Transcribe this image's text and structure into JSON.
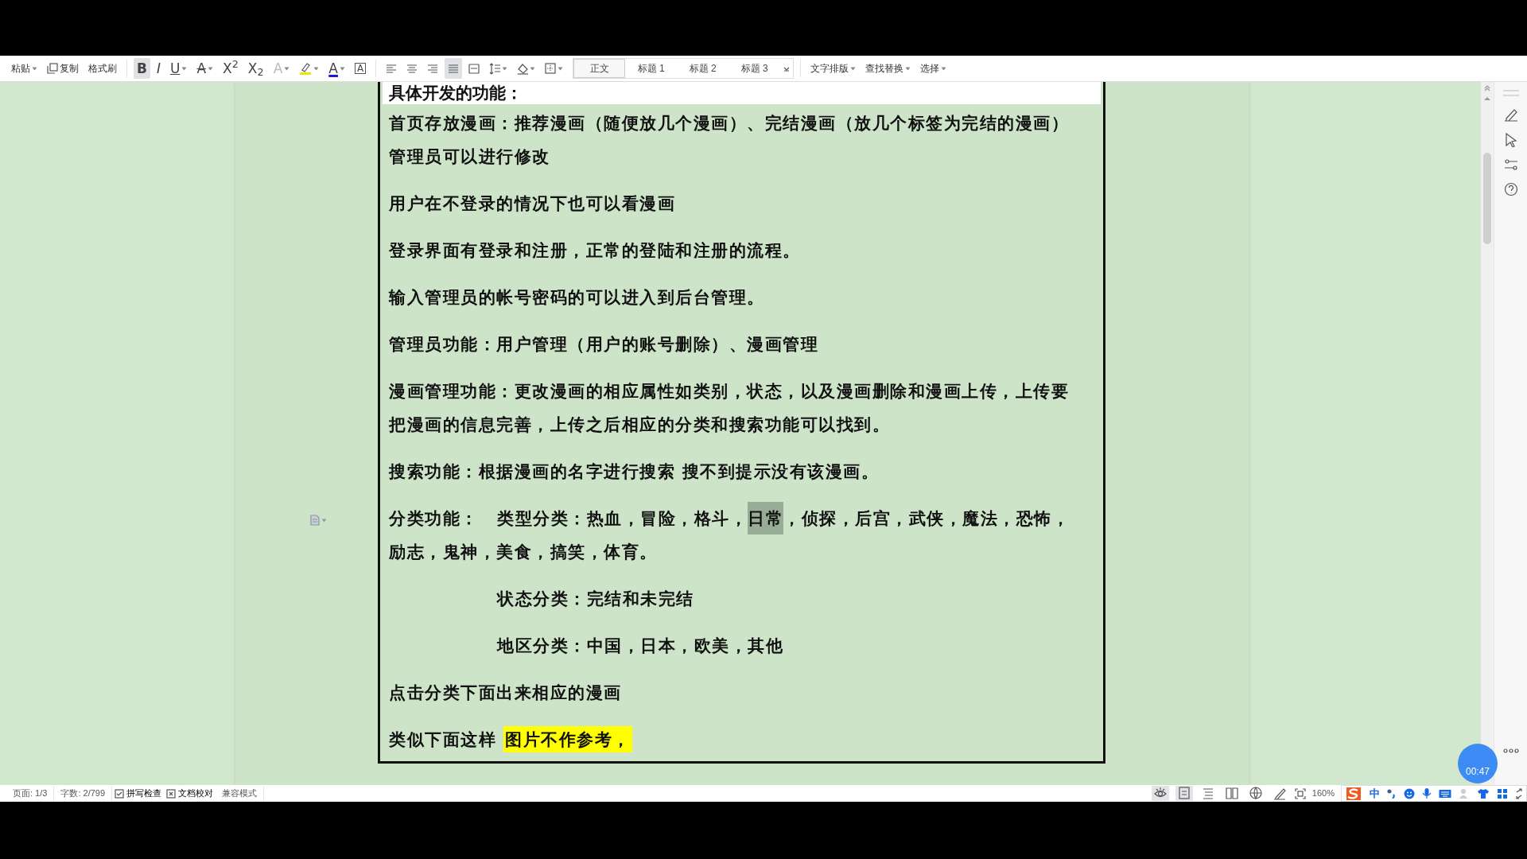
{
  "toolbar": {
    "clipboard": [
      {
        "kind": "paste",
        "label": "粘贴",
        "dropdown": true
      },
      {
        "kind": "copy",
        "label": "复制",
        "dropdown": false
      },
      {
        "kind": "painter",
        "label": "格式刷",
        "dropdown": false
      }
    ],
    "font_buttons": [
      {
        "kind": "bold",
        "glyph": "B",
        "selected": true,
        "dropdown": false
      },
      {
        "kind": "italic",
        "glyph": "I",
        "selected": false,
        "dropdown": false
      },
      {
        "kind": "underline",
        "glyph": "U",
        "selected": false,
        "dropdown": true
      },
      {
        "kind": "strike",
        "glyph": "A",
        "selected": false,
        "dropdown": true
      },
      {
        "kind": "superscript",
        "glyph": "X$^{2}$",
        "selected": false,
        "dropdown": false
      },
      {
        "kind": "subscript",
        "glyph": "X$_{2}$",
        "selected": false,
        "dropdown": false
      },
      {
        "kind": "effect",
        "glyph": "A",
        "selected": false,
        "dropdown": true
      },
      {
        "kind": "highlight",
        "selected": false,
        "dropdown": true
      },
      {
        "kind": "font-color",
        "glyph": "A",
        "selected": false,
        "dropdown": true
      },
      {
        "kind": "char-border",
        "glyph": "A",
        "selected": false,
        "dropdown": false
      }
    ],
    "paragraph_buttons": [
      {
        "kind": "align-left",
        "selected": false,
        "dropdown": false
      },
      {
        "kind": "align-center",
        "selected": false,
        "dropdown": false
      },
      {
        "kind": "align-right",
        "selected": false,
        "dropdown": false
      },
      {
        "kind": "justify",
        "selected": true,
        "dropdown": false
      },
      {
        "kind": "distribute",
        "selected": false,
        "dropdown": false
      },
      {
        "kind": "line-spacing",
        "selected": false,
        "dropdown": true
      },
      {
        "kind": "shading",
        "selected": false,
        "dropdown": true
      },
      {
        "kind": "borders",
        "selected": false,
        "dropdown": true
      }
    ],
    "styles": [
      {
        "label": "正文",
        "selected": true
      },
      {
        "label": "标题 1",
        "selected": false
      },
      {
        "label": "标题 2",
        "selected": false
      },
      {
        "label": "标题 3",
        "selected": false
      }
    ],
    "menus": [
      "文字排版",
      "查找替换",
      "选择"
    ]
  },
  "document": {
    "cut_line": "具体开发的功能：",
    "paragraphs": [
      {
        "kind": "plain",
        "lines": [
          [
            {
              "text": "首页存放漫画：推荐漫画（随便放几个漫画）、完结漫画（放几个标签为完结的漫画）"
            }
          ],
          [
            {
              "text": "管理员可以进行修改"
            }
          ]
        ]
      },
      {
        "kind": "plain",
        "lines": [
          [
            {
              "text": "用户在不登录的情况下也可以看漫画"
            }
          ]
        ]
      },
      {
        "kind": "plain",
        "lines": [
          [
            {
              "text": "登录界面有登录和注册，正常的登陆和注册的流程。"
            }
          ]
        ]
      },
      {
        "kind": "plain",
        "lines": [
          [
            {
              "text": "输入管理员的帐号密码的可以进入到后台管理。"
            }
          ]
        ]
      },
      {
        "kind": "plain",
        "lines": [
          [
            {
              "text": "管理员功能：用户管理（用户的账号删除）、漫画管理"
            }
          ]
        ]
      },
      {
        "kind": "plain",
        "lines": [
          [
            {
              "text": "漫画管理功能：更改漫画的相应属性如类别，状态，以及漫画删除和漫画上传，上传要"
            }
          ],
          [
            {
              "text": "把漫画的信息完善，上传之后相应的分类和搜索功能可以找到。"
            }
          ]
        ]
      },
      {
        "kind": "plain",
        "lines": [
          [
            {
              "text": "搜索功能：根据漫画的名字进行搜索 搜不到提示没有该漫画。"
            }
          ]
        ]
      },
      {
        "kind": "tabbed",
        "lines": [
          [
            {
              "text": "分类功能："
            },
            {
              "text": "类型分类：热血，冒险，格斗，"
            },
            {
              "text": "日常",
              "kind": "selection"
            },
            {
              "text": "，侦探，后宫，武侠，魔法，恐怖，"
            }
          ],
          [
            {
              "text": "励志，鬼神，美食，搞笑，体育。"
            }
          ]
        ]
      },
      {
        "kind": "indented",
        "lines": [
          [
            {
              "text": "状态分类：完结和未完结"
            }
          ]
        ]
      },
      {
        "kind": "indented",
        "lines": [
          [
            {
              "text": "地区分类：中国，日本，欧美，其他"
            }
          ]
        ]
      },
      {
        "kind": "plain",
        "lines": [
          [
            {
              "text": "点击分类下面出来相应的漫画"
            }
          ]
        ]
      },
      {
        "kind": "tabbed",
        "lines": [
          [
            {
              "text": "类似下面这样"
            },
            {
              "text": "图片不作参考，",
              "kind": "highlight"
            }
          ]
        ]
      }
    ]
  },
  "status_bar": {
    "items": [
      {
        "kind": "text",
        "label": "页面: 1/3"
      },
      {
        "kind": "text",
        "label": "字数: 2/799"
      },
      {
        "kind": "check",
        "label": "拼写检查"
      },
      {
        "kind": "cross",
        "label": "文档校对"
      },
      {
        "kind": "text",
        "label": "兼容模式"
      }
    ],
    "views": [
      {
        "kind": "eye",
        "selected": true
      },
      {
        "kind": "page",
        "selected": true
      },
      {
        "kind": "outline",
        "selected": false
      },
      {
        "kind": "reading",
        "selected": false
      },
      {
        "kind": "web",
        "selected": false
      },
      {
        "kind": "write",
        "selected": false
      }
    ],
    "zoom": "160%",
    "ime_mode": "中"
  },
  "timer": "00:47"
}
